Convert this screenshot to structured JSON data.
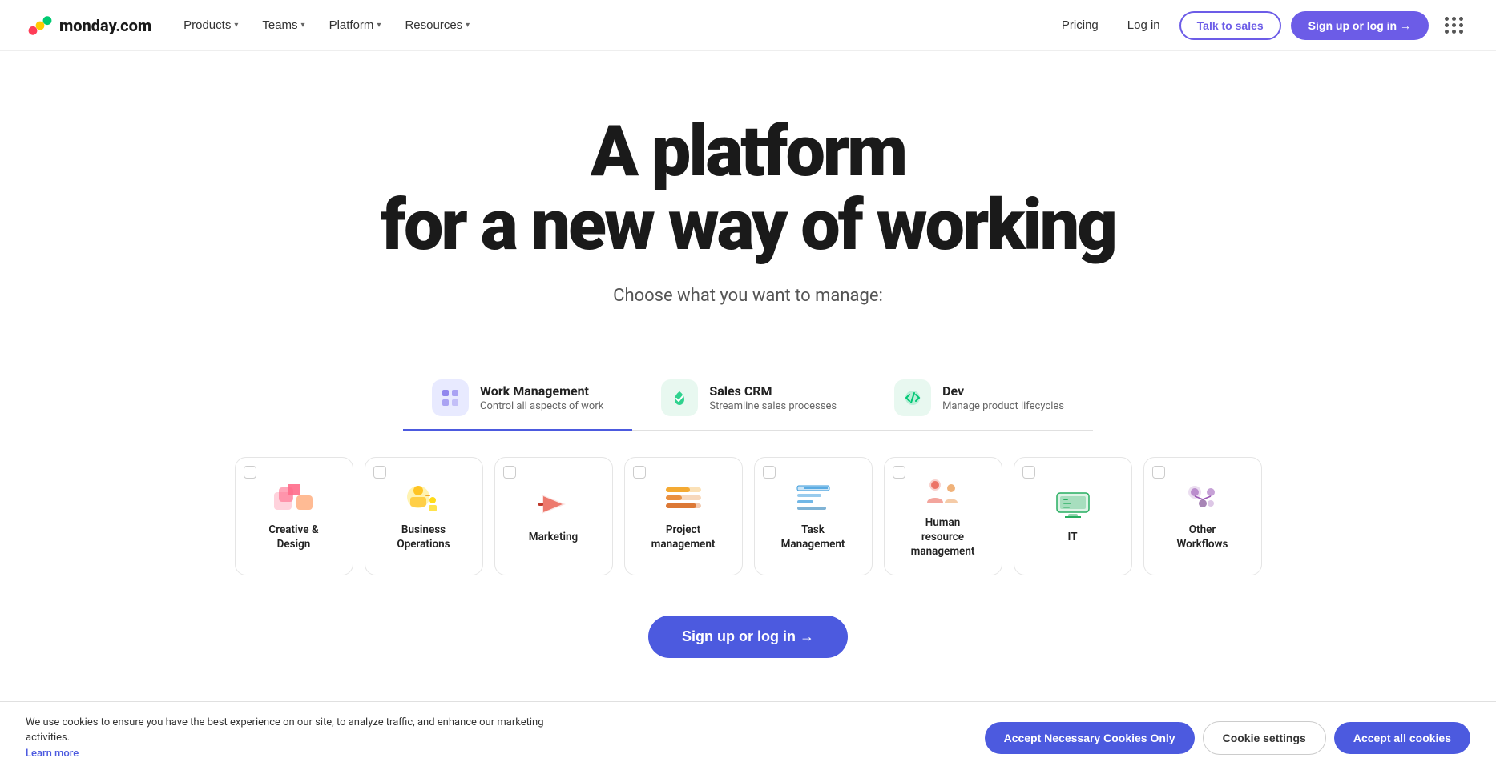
{
  "nav": {
    "logo_alt": "monday.com",
    "links": [
      {
        "label": "Products",
        "id": "products"
      },
      {
        "label": "Teams",
        "id": "teams"
      },
      {
        "label": "Platform",
        "id": "platform"
      },
      {
        "label": "Resources",
        "id": "resources"
      }
    ],
    "pricing": "Pricing",
    "login": "Log in",
    "talk_to_sales": "Talk to sales",
    "signup": "Sign up or log in →"
  },
  "hero": {
    "line1": "A platform",
    "line2": "for a new way of working",
    "subtitle": "Choose what you want to manage:"
  },
  "tabs": [
    {
      "id": "work-management",
      "title": "Work Management",
      "desc": "Control all aspects of work",
      "active": true,
      "icon_color": "#e8eaff",
      "icon": "⊞"
    },
    {
      "id": "sales-crm",
      "title": "Sales CRM",
      "desc": "Streamline sales processes",
      "active": false,
      "icon_color": "#e8f8f0",
      "icon": "↺"
    },
    {
      "id": "dev",
      "title": "Dev",
      "desc": "Manage product lifecycles",
      "active": false,
      "icon_color": "#e8f8f0",
      "icon": "⚙"
    }
  ],
  "cards": [
    {
      "id": "creative-design",
      "label": "Creative &\nDesign",
      "icon_type": "creative"
    },
    {
      "id": "business-operations",
      "label": "Business\nOperations",
      "icon_type": "business"
    },
    {
      "id": "marketing",
      "label": "Marketing",
      "icon_type": "marketing"
    },
    {
      "id": "project-management",
      "label": "Project\nmanagement",
      "icon_type": "project"
    },
    {
      "id": "task-management",
      "label": "Task\nManagement",
      "icon_type": "task"
    },
    {
      "id": "human-resource",
      "label": "Human\nresource\nmanagement",
      "icon_type": "hr"
    },
    {
      "id": "it",
      "label": "IT",
      "icon_type": "it"
    },
    {
      "id": "other-workflows",
      "label": "Other\nWorkflows",
      "icon_type": "other"
    }
  ],
  "cta": {
    "label": "Sign up or log in →"
  },
  "cookie": {
    "message": "We use cookies to ensure you have the best experience on our site, to analyze traffic, and enhance our marketing activities.",
    "learn_more": "Learn more",
    "btn_necessary": "Accept Necessary Cookies Only",
    "btn_settings": "Cookie settings",
    "btn_accept_all": "Accept all cookies"
  }
}
